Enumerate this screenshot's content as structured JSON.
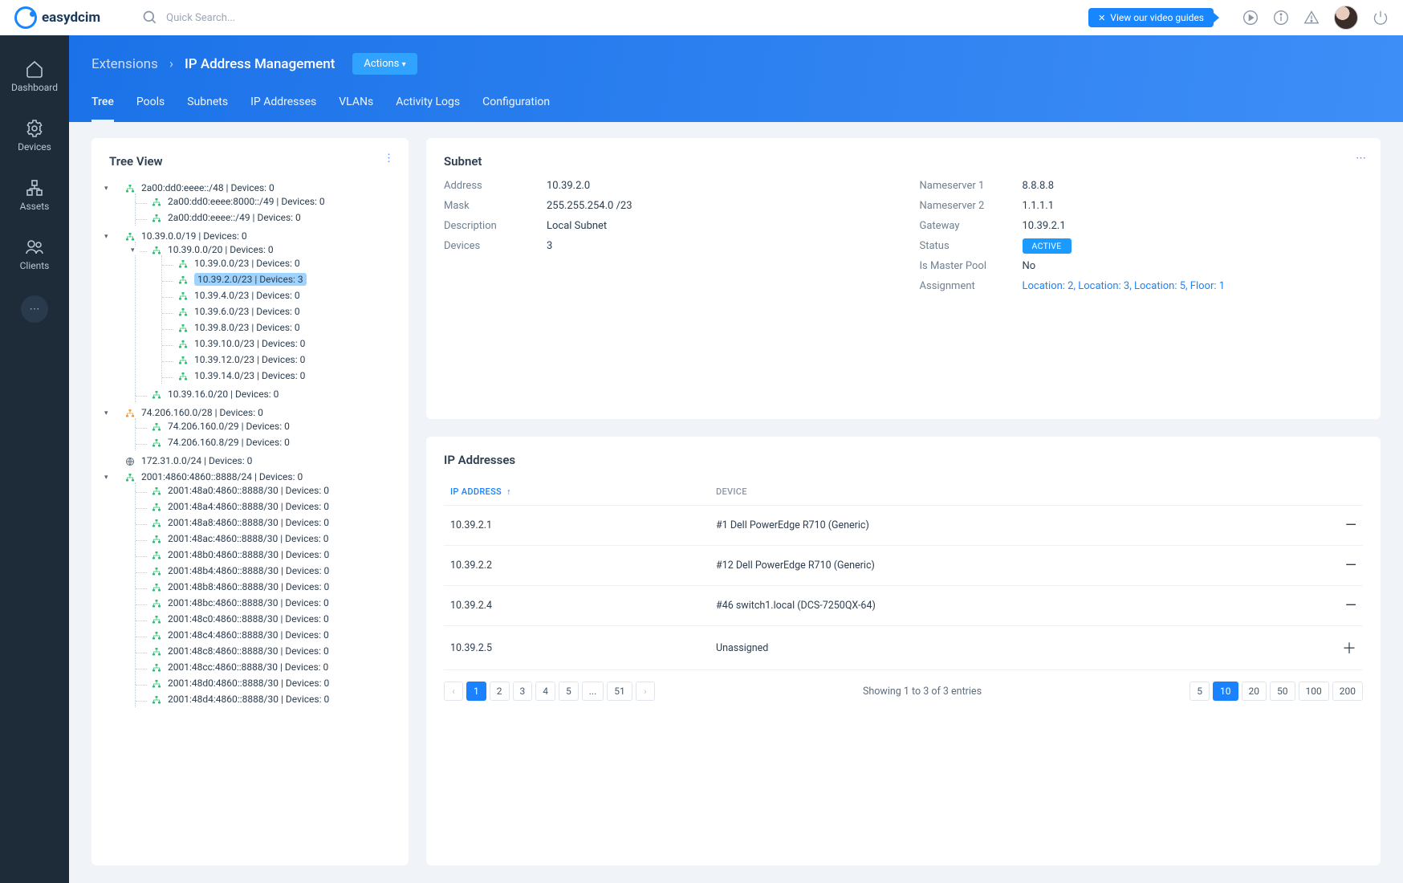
{
  "logo": {
    "text": "easydcim"
  },
  "search": {
    "placeholder": "Quick Search..."
  },
  "video_guide": "View our video guides",
  "sidebar": {
    "items": [
      {
        "label": "Dashboard"
      },
      {
        "label": "Devices"
      },
      {
        "label": "Assets"
      },
      {
        "label": "Clients"
      }
    ]
  },
  "breadcrumb": {
    "a": "Extensions",
    "b": "IP Address Management",
    "actions": "Actions"
  },
  "tabs": [
    "Tree",
    "Pools",
    "Subnets",
    "IP Addresses",
    "VLANs",
    "Activity Logs",
    "Configuration"
  ],
  "active_tab": 0,
  "tree_title": "Tree View",
  "tree": [
    {
      "label": "2a00:dd0:eeee::/48 | Devices: 0",
      "ico": "green",
      "open": true,
      "children": [
        {
          "label": "2a00:dd0:eeee:8000::/49 | Devices: 0",
          "ico": "green"
        },
        {
          "label": "2a00:dd0:eeee::/49 | Devices: 0",
          "ico": "green"
        }
      ]
    },
    {
      "label": "10.39.0.0/19 | Devices: 0",
      "ico": "green",
      "open": true,
      "children": [
        {
          "label": "10.39.0.0/20 | Devices: 0",
          "ico": "green",
          "open": true,
          "children": [
            {
              "label": "10.39.0.0/23 | Devices: 0",
              "ico": "green"
            },
            {
              "label": "10.39.2.0/23 | Devices: 3",
              "ico": "green",
              "selected": true
            },
            {
              "label": "10.39.4.0/23 | Devices: 0",
              "ico": "green"
            },
            {
              "label": "10.39.6.0/23 | Devices: 0",
              "ico": "green"
            },
            {
              "label": "10.39.8.0/23 | Devices: 0",
              "ico": "green"
            },
            {
              "label": "10.39.10.0/23 | Devices: 0",
              "ico": "green"
            },
            {
              "label": "10.39.12.0/23 | Devices: 0",
              "ico": "green"
            },
            {
              "label": "10.39.14.0/23 | Devices: 0",
              "ico": "green"
            }
          ]
        },
        {
          "label": "10.39.16.0/20 | Devices: 0",
          "ico": "green"
        }
      ]
    },
    {
      "label": "74.206.160.0/28 | Devices: 0",
      "ico": "orange",
      "open": true,
      "children": [
        {
          "label": "74.206.160.0/29 | Devices: 0",
          "ico": "green"
        },
        {
          "label": "74.206.160.8/29 | Devices: 0",
          "ico": "green"
        }
      ]
    },
    {
      "label": "172.31.0.0/24 | Devices: 0",
      "ico": "grey"
    },
    {
      "label": "2001:4860:4860::8888/24 | Devices: 0",
      "ico": "green",
      "open": true,
      "children": [
        {
          "label": "2001:48a0:4860::8888/30 | Devices: 0",
          "ico": "green"
        },
        {
          "label": "2001:48a4:4860::8888/30 | Devices: 0",
          "ico": "green"
        },
        {
          "label": "2001:48a8:4860::8888/30 | Devices: 0",
          "ico": "green"
        },
        {
          "label": "2001:48ac:4860::8888/30 | Devices: 0",
          "ico": "green"
        },
        {
          "label": "2001:48b0:4860::8888/30 | Devices: 0",
          "ico": "green"
        },
        {
          "label": "2001:48b4:4860::8888/30 | Devices: 0",
          "ico": "green"
        },
        {
          "label": "2001:48b8:4860::8888/30 | Devices: 0",
          "ico": "green"
        },
        {
          "label": "2001:48bc:4860::8888/30 | Devices: 0",
          "ico": "green"
        },
        {
          "label": "2001:48c0:4860::8888/30 | Devices: 0",
          "ico": "green"
        },
        {
          "label": "2001:48c4:4860::8888/30 | Devices: 0",
          "ico": "green"
        },
        {
          "label": "2001:48c8:4860::8888/30 | Devices: 0",
          "ico": "green"
        },
        {
          "label": "2001:48cc:4860::8888/30 | Devices: 0",
          "ico": "green"
        },
        {
          "label": "2001:48d0:4860::8888/30 | Devices: 0",
          "ico": "green"
        },
        {
          "label": "2001:48d4:4860::8888/30 | Devices: 0",
          "ico": "green"
        }
      ]
    }
  ],
  "subnet": {
    "title": "Subnet",
    "left": [
      {
        "k": "Address",
        "v": "10.39.2.0"
      },
      {
        "k": "Mask",
        "v": "255.255.254.0 /23"
      },
      {
        "k": "Description",
        "v": "Local Subnet"
      },
      {
        "k": "Devices",
        "v": "3"
      }
    ],
    "right": [
      {
        "k": "Nameserver 1",
        "v": "8.8.8.8"
      },
      {
        "k": "Nameserver 2",
        "v": "1.1.1.1"
      },
      {
        "k": "Gateway",
        "v": "10.39.2.1"
      },
      {
        "k": "Status",
        "v": "ACTIVE",
        "badge": true
      },
      {
        "k": "Is Master Pool",
        "v": "No"
      },
      {
        "k": "Assignment",
        "v": "Location: 2, Location: 3, Location: 5, Floor: 1",
        "link": true
      }
    ]
  },
  "ip_table": {
    "title": "IP Addresses",
    "headers": [
      "IP ADDRESS",
      "DEVICE"
    ],
    "rows": [
      {
        "ip": "10.39.2.1",
        "device": "#1 Dell PowerEdge R710 (Generic)",
        "action": "minus"
      },
      {
        "ip": "10.39.2.2",
        "device": "#12 Dell PowerEdge R710 (Generic)",
        "action": "minus"
      },
      {
        "ip": "10.39.2.4",
        "device": "#46 switch1.local (DCS-7250QX-64)",
        "action": "minus"
      },
      {
        "ip": "10.39.2.5",
        "device": "Unassigned",
        "action": "plus"
      }
    ],
    "summary": "Showing 1 to 3 of 3 entries",
    "pages": [
      "1",
      "2",
      "3",
      "4",
      "5",
      "...",
      "51"
    ],
    "active_page": 1,
    "page_sizes": [
      "5",
      "10",
      "20",
      "50",
      "100",
      "200"
    ],
    "active_size": "10"
  }
}
